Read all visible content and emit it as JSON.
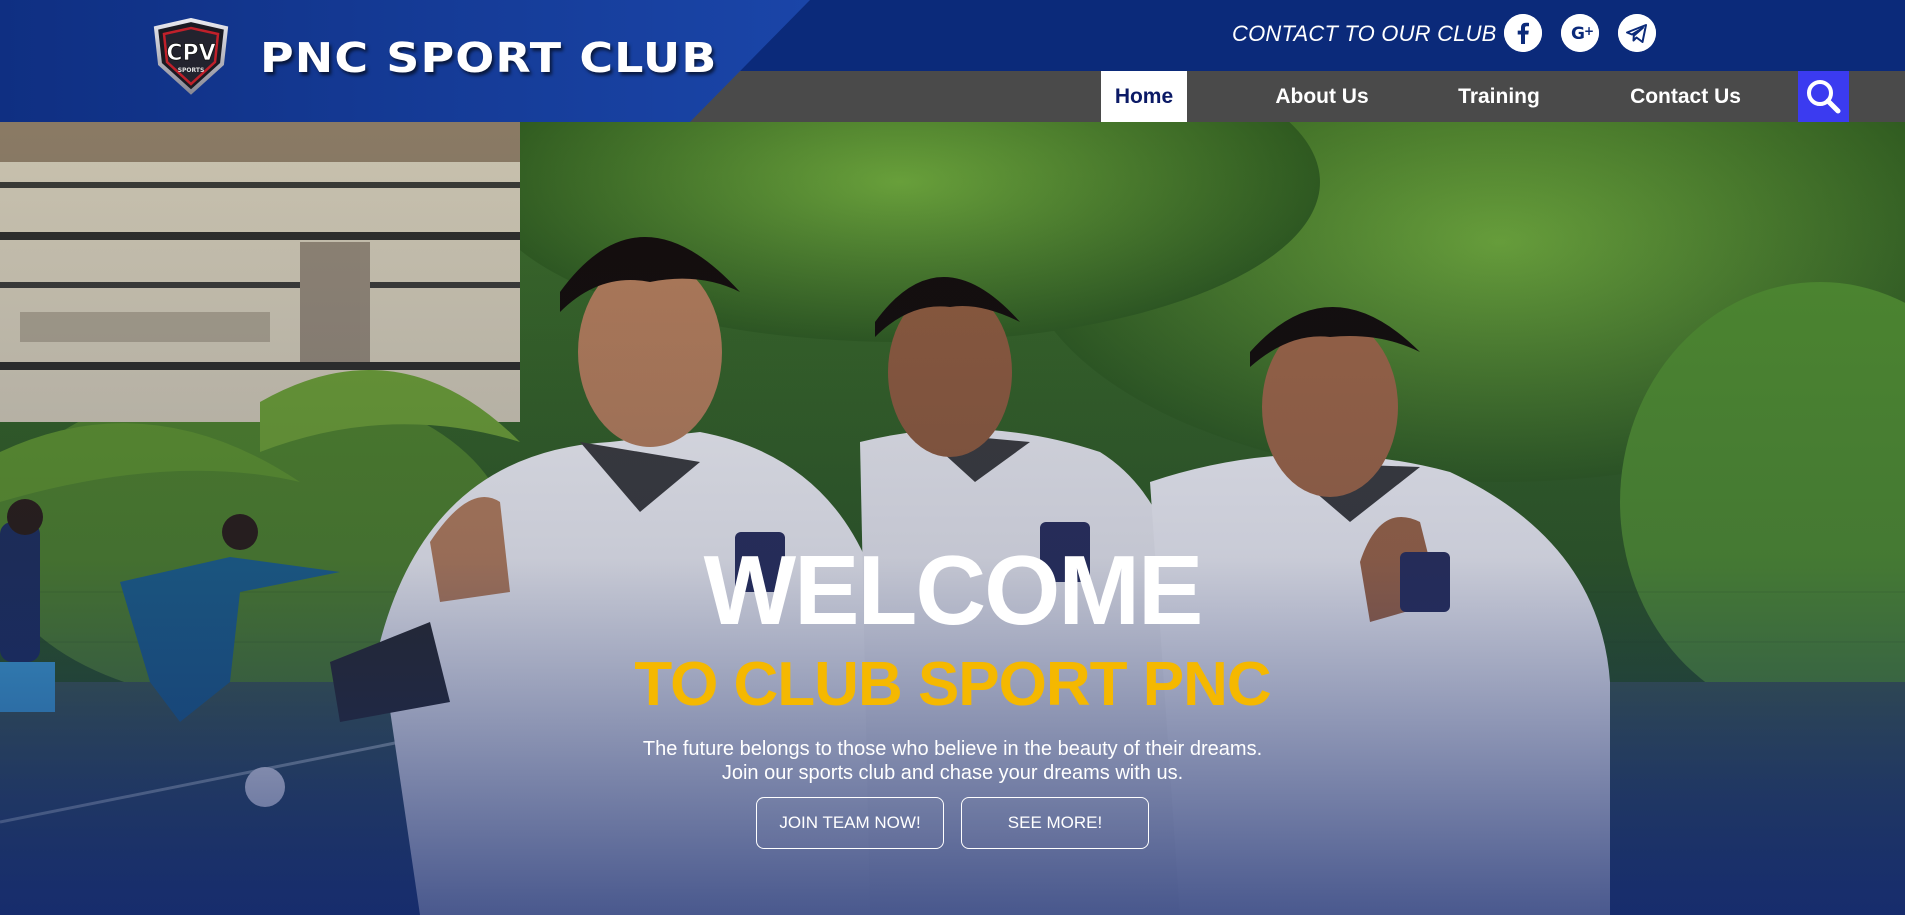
{
  "header": {
    "logo_text": "CPV",
    "logo_subtext": "SPORTS",
    "brand_title": "PNC SPORT CLUB",
    "contact_text": "CONTACT TO OUR CLUB",
    "social": [
      {
        "icon": "facebook-icon"
      },
      {
        "icon": "google-plus-icon"
      },
      {
        "icon": "telegram-icon"
      }
    ]
  },
  "nav": {
    "items": [
      {
        "label": "Home",
        "active": true
      },
      {
        "label": "About Us",
        "active": false
      },
      {
        "label": "Training",
        "active": false
      },
      {
        "label": "Contact Us",
        "active": false
      }
    ],
    "search_icon": "search-icon"
  },
  "hero": {
    "title": "WELCOME",
    "subtitle": "TO CLUB SPORT PNC",
    "tagline_line1": "The future belongs to those who believe in the beauty of their dreams.",
    "tagline_line2": "Join our sports club and chase your dreams with us.",
    "join_button": "JOIN TEAM NOW!",
    "more_button": "SEE MORE!"
  },
  "colors": {
    "top_bar": "#0b2a7a",
    "nav_bar": "#4a4a4a",
    "accent_yellow": "#f5b800",
    "search_bg": "#3b3bf0",
    "home_text": "#0b1a66"
  }
}
